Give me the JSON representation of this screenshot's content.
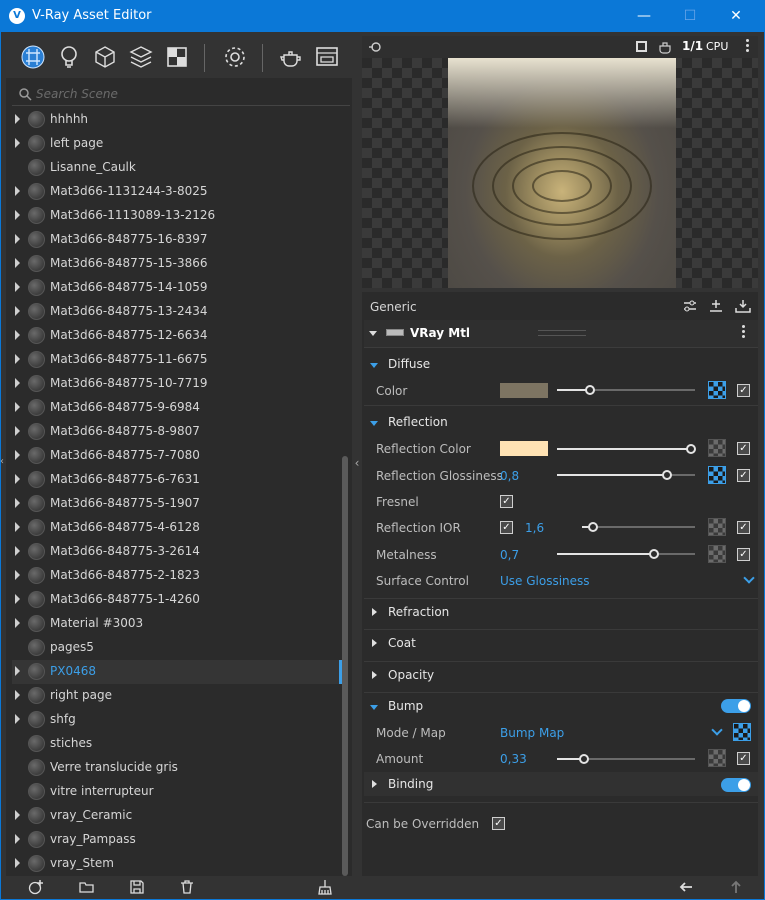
{
  "window": {
    "title": "V-Ray Asset Editor",
    "logo": "V",
    "minimize": "—",
    "maximize": "☐",
    "close": "✕"
  },
  "toolbar": {
    "icons": [
      "materials-icon",
      "lights-icon",
      "geometry-icon",
      "layers-icon",
      "textures-icon",
      "settings-icon",
      "render-teapot-icon",
      "render-window-icon"
    ]
  },
  "search": {
    "placeholder": "Search Scene"
  },
  "tree": {
    "items": [
      {
        "label": "hhhhh",
        "expand": true
      },
      {
        "label": "left page",
        "expand": true
      },
      {
        "label": "Lisanne_Caulk",
        "expand": false
      },
      {
        "label": "Mat3d66-1131244-3-8025",
        "expand": true
      },
      {
        "label": "Mat3d66-1113089-13-2126",
        "expand": true
      },
      {
        "label": "Mat3d66-848775-16-8397",
        "expand": true
      },
      {
        "label": "Mat3d66-848775-15-3866",
        "expand": true
      },
      {
        "label": "Mat3d66-848775-14-1059",
        "expand": true
      },
      {
        "label": "Mat3d66-848775-13-2434",
        "expand": true
      },
      {
        "label": "Mat3d66-848775-12-6634",
        "expand": true
      },
      {
        "label": "Mat3d66-848775-11-6675",
        "expand": true
      },
      {
        "label": "Mat3d66-848775-10-7719",
        "expand": true
      },
      {
        "label": "Mat3d66-848775-9-6984",
        "expand": true
      },
      {
        "label": "Mat3d66-848775-8-9807",
        "expand": true
      },
      {
        "label": "Mat3d66-848775-7-7080",
        "expand": true
      },
      {
        "label": "Mat3d66-848775-6-7631",
        "expand": true
      },
      {
        "label": "Mat3d66-848775-5-1907",
        "expand": true
      },
      {
        "label": "Mat3d66-848775-4-6128",
        "expand": true
      },
      {
        "label": "Mat3d66-848775-3-2614",
        "expand": true
      },
      {
        "label": "Mat3d66-848775-2-1823",
        "expand": true
      },
      {
        "label": "Mat3d66-848775-1-4260",
        "expand": true
      },
      {
        "label": "Material #3003",
        "expand": true
      },
      {
        "label": "pages5",
        "expand": false
      },
      {
        "label": "PX0468",
        "expand": true,
        "selected": true
      },
      {
        "label": "right page",
        "expand": true
      },
      {
        "label": "shfg",
        "expand": true
      },
      {
        "label": "stiches",
        "expand": false
      },
      {
        "label": "Verre translucide gris",
        "expand": false
      },
      {
        "label": "vitre interrupteur",
        "expand": false
      },
      {
        "label": "vray_Ceramic",
        "expand": true
      },
      {
        "label": "vray_Pampass",
        "expand": true
      },
      {
        "label": "vray_Stem",
        "expand": true
      }
    ]
  },
  "preview_bar": {
    "ratio": "1/1",
    "device": "CPU"
  },
  "props": {
    "generic_label": "Generic",
    "material_name": "VRay Mtl",
    "diffuse": {
      "title": "Diffuse",
      "color_label": "Color",
      "color": "#7d7462"
    },
    "reflection": {
      "title": "Reflection",
      "color_label": "Reflection Color",
      "color": "#ffe2b4",
      "color_level": 0.97,
      "glossiness_label": "Reflection Glossiness",
      "glossiness_value": "0,8",
      "fresnel_label": "Fresnel",
      "ior_label": "Reflection IOR",
      "ior_value": "1,6",
      "metalness_label": "Metalness",
      "metalness_value": "0,7",
      "surface_label": "Surface Control",
      "surface_value": "Use Glossiness"
    },
    "refraction": {
      "title": "Refraction"
    },
    "coat": {
      "title": "Coat"
    },
    "opacity": {
      "title": "Opacity"
    },
    "bump": {
      "title": "Bump",
      "mode_label": "Mode / Map",
      "mode_value": "Bump Map",
      "amount_label": "Amount",
      "amount_value": "0,33"
    },
    "binding": {
      "title": "Binding"
    },
    "override_label": "Can be Overridden"
  },
  "colors": {
    "accent": "#3c9fe8",
    "titlebar": "#0b78d7"
  }
}
